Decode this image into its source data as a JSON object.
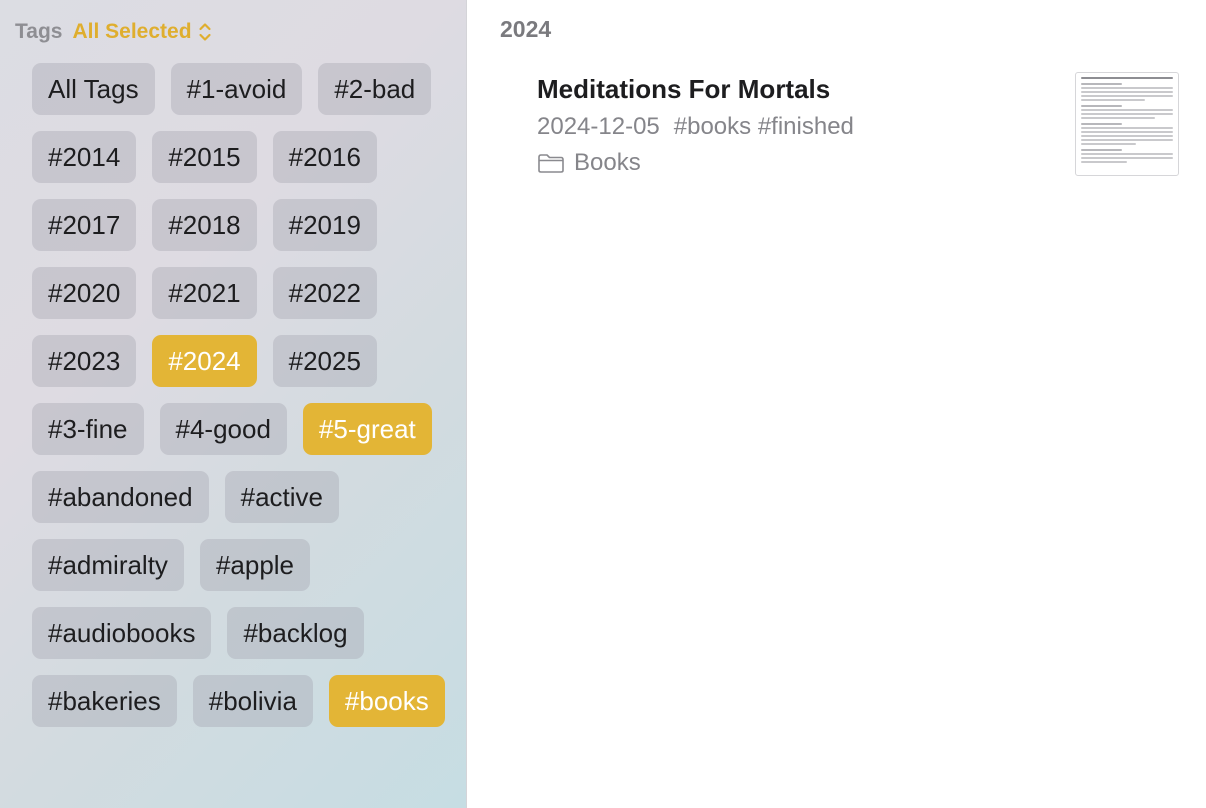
{
  "sidebar": {
    "tags_label": "Tags",
    "filter_value": "All Selected",
    "accent_color": "#e3b536",
    "chips": [
      {
        "label": "All Tags",
        "selected": false
      },
      {
        "label": "#1-avoid",
        "selected": false
      },
      {
        "label": "#2-bad",
        "selected": false
      },
      {
        "label": "#2014",
        "selected": false
      },
      {
        "label": "#2015",
        "selected": false
      },
      {
        "label": "#2016",
        "selected": false
      },
      {
        "label": "#2017",
        "selected": false
      },
      {
        "label": "#2018",
        "selected": false
      },
      {
        "label": "#2019",
        "selected": false
      },
      {
        "label": "#2020",
        "selected": false
      },
      {
        "label": "#2021",
        "selected": false
      },
      {
        "label": "#2022",
        "selected": false
      },
      {
        "label": "#2023",
        "selected": false
      },
      {
        "label": "#2024",
        "selected": true
      },
      {
        "label": "#2025",
        "selected": false
      },
      {
        "label": "#3-fine",
        "selected": false
      },
      {
        "label": "#4-good",
        "selected": false
      },
      {
        "label": "#5-great",
        "selected": true
      },
      {
        "label": "#abandoned",
        "selected": false
      },
      {
        "label": "#active",
        "selected": false
      },
      {
        "label": "#admiralty",
        "selected": false
      },
      {
        "label": "#apple",
        "selected": false
      },
      {
        "label": "#audiobooks",
        "selected": false
      },
      {
        "label": "#backlog",
        "selected": false
      },
      {
        "label": "#bakeries",
        "selected": false
      },
      {
        "label": "#bolivia",
        "selected": false
      },
      {
        "label": "#books",
        "selected": true
      }
    ]
  },
  "main": {
    "section_title": "2024",
    "notes": [
      {
        "title": "Meditations For Mortals",
        "date": "2024-12-05",
        "tags": "#books #finished",
        "folder": "Books",
        "folder_icon": "folder-icon"
      }
    ]
  }
}
